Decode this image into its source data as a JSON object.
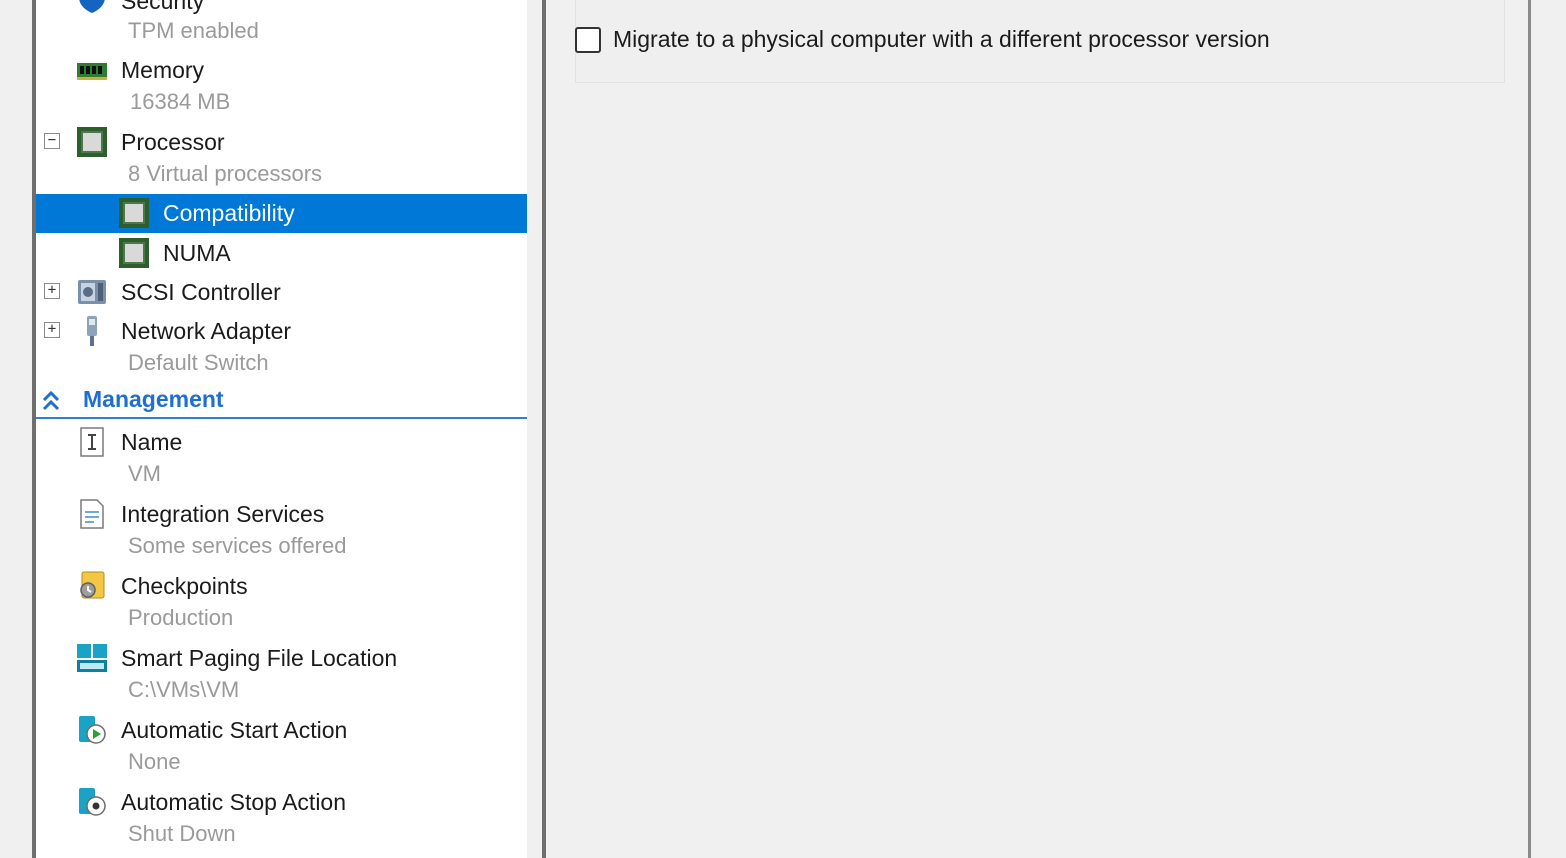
{
  "tree": {
    "security": {
      "title": "Security",
      "subtitle": "TPM enabled"
    },
    "memory": {
      "title": "Memory",
      "subtitle": "16384 MB"
    },
    "processor": {
      "title": "Processor",
      "subtitle": "8 Virtual processors",
      "expander": "−"
    },
    "compatibility": {
      "title": "Compatibility"
    },
    "numa": {
      "title": "NUMA"
    },
    "scsi": {
      "title": "SCSI Controller",
      "expander": "+"
    },
    "network": {
      "title": "Network Adapter",
      "subtitle": "Default Switch",
      "expander": "+"
    },
    "management_header": "Management",
    "name": {
      "title": "Name",
      "subtitle": "VM"
    },
    "integration": {
      "title": "Integration Services",
      "subtitle": "Some services offered"
    },
    "checkpoints": {
      "title": "Checkpoints",
      "subtitle": "Production"
    },
    "smart_paging": {
      "title": "Smart Paging File Location",
      "subtitle": "C:\\VMs\\VM"
    },
    "auto_start": {
      "title": "Automatic Start Action",
      "subtitle": "None"
    },
    "auto_stop": {
      "title": "Automatic Stop Action",
      "subtitle": "Shut Down"
    }
  },
  "settings": {
    "migrate_checkbox_label": "Migrate to a physical computer with a different processor version",
    "migrate_checked": false
  },
  "colors": {
    "selection": "#0078d7",
    "section_header": "#1e6fd0",
    "subtitle_text": "#9a9a9a"
  }
}
